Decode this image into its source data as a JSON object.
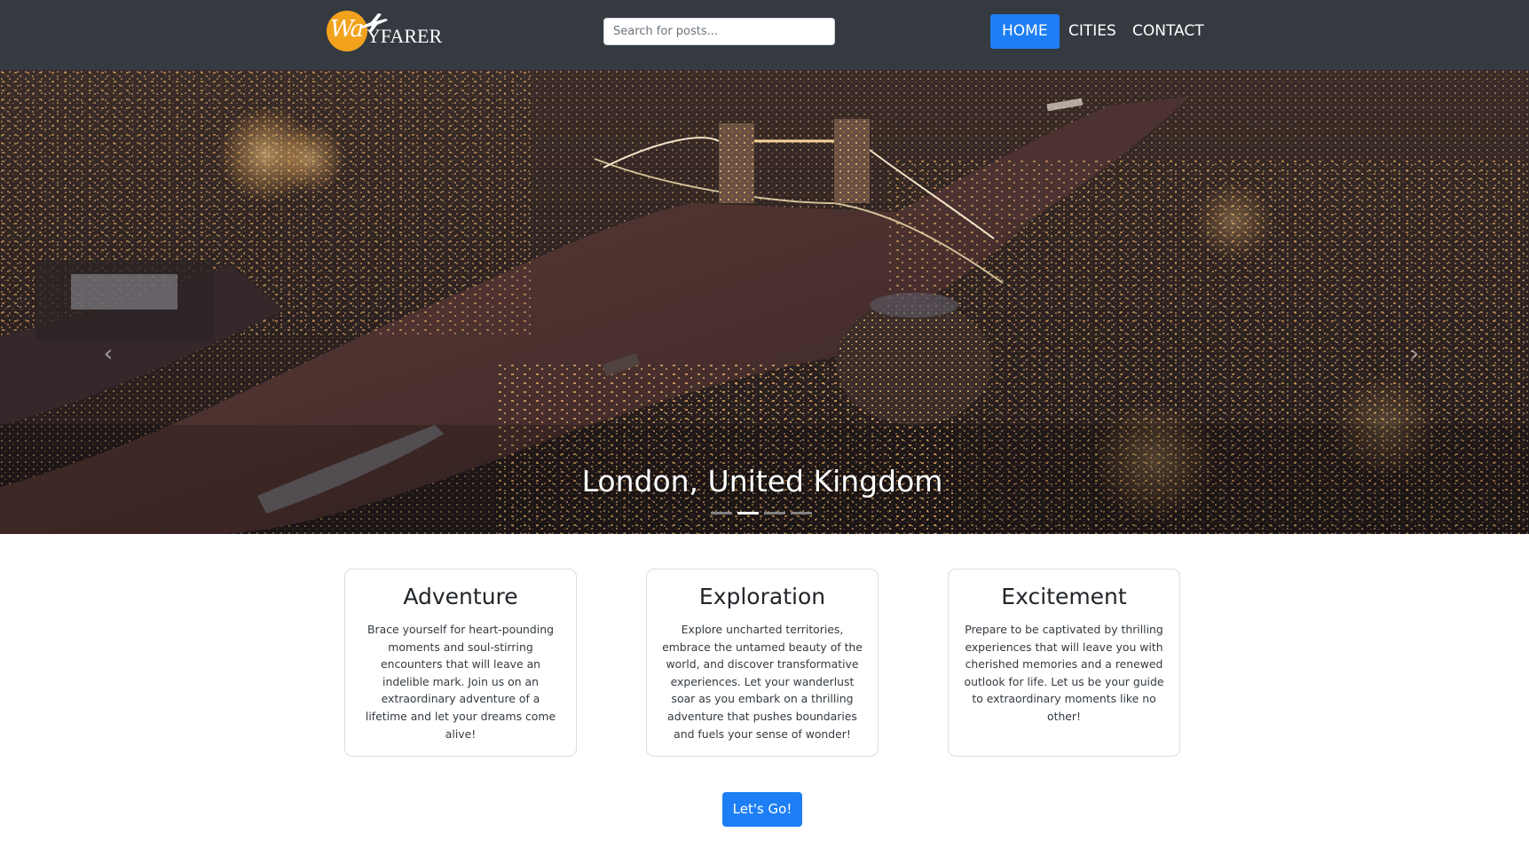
{
  "brand": {
    "script": "Wa",
    "name": "YFARER"
  },
  "search": {
    "placeholder": "Search for posts..."
  },
  "nav": {
    "home": "HOME",
    "cities": "CITIES",
    "contact": "CONTACT",
    "active": "HOME"
  },
  "hero": {
    "caption": "London, United Kingdom",
    "slide_count": 4,
    "active_slide": 2
  },
  "cards": [
    {
      "title": "Adventure",
      "text": "Brace yourself for heart-pounding moments and soul-stirring encounters that will leave an indelible mark. Join us on an extraordinary adventure of a lifetime and let your dreams come alive!"
    },
    {
      "title": "Exploration",
      "text": "Explore uncharted territories, embrace the untamed beauty of the world, and discover transformative experiences. Let your wanderlust soar as you embark on a thrilling adventure that pushes boundaries and fuels your sense of wonder!"
    },
    {
      "title": "Excitement",
      "text": "Prepare to be captivated by thrilling experiences that will leave you with cherished memories and a renewed outlook for life. Let us be your guide to extraordinary moments like no other!"
    }
  ],
  "cta": {
    "label": "Let's Go!"
  },
  "colors": {
    "navbar": "#343a40",
    "accent": "#1d7ef5",
    "logo": "#f2a21c",
    "card_border": "#d9dcdf"
  },
  "icons": {
    "logo": "airplane-logo-icon",
    "carousel_prev": "chevron-left-icon",
    "carousel_next": "chevron-right-icon"
  }
}
